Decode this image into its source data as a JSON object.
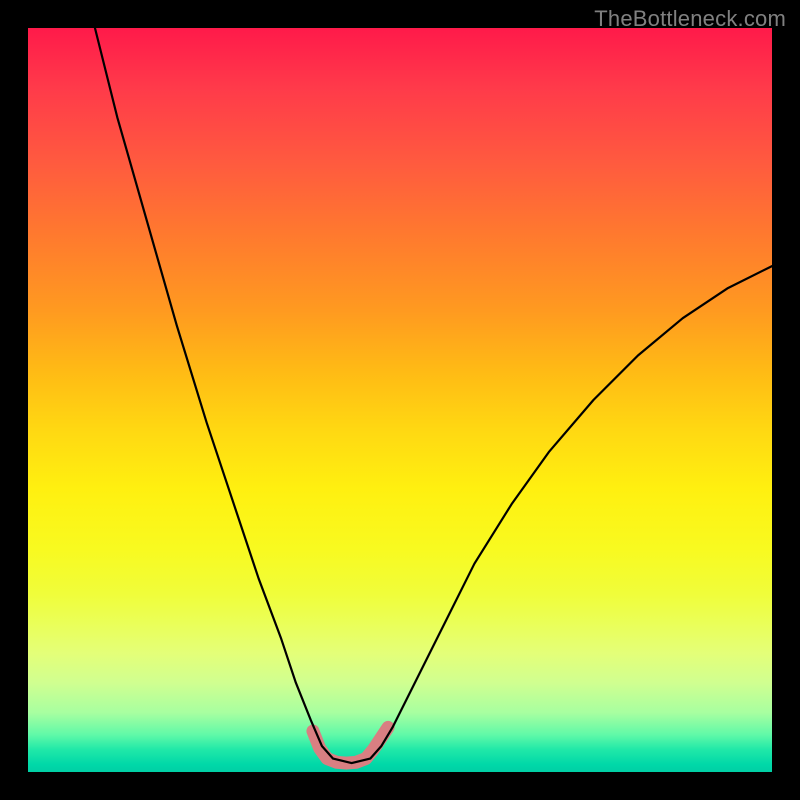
{
  "watermark": "TheBottleneck.com",
  "gradient": {
    "top": "#ff1a4a",
    "bottom": "#00cfa5",
    "direction": "vertical"
  },
  "chart_data": {
    "type": "line",
    "title": "",
    "xlabel": "",
    "ylabel": "",
    "xlim": [
      0,
      100
    ],
    "ylim": [
      0,
      100
    ],
    "series": [
      {
        "name": "main-curve",
        "color": "#000000",
        "stroke_width": 2.2,
        "x": [
          9,
          12,
          16,
          20,
          24,
          28,
          31,
          34,
          36,
          38,
          39.5,
          41,
          43.5,
          46,
          47.5,
          49,
          52,
          56,
          60,
          65,
          70,
          76,
          82,
          88,
          94,
          100
        ],
        "values": [
          100,
          88,
          74,
          60,
          47,
          35,
          26,
          18,
          12,
          7,
          3.5,
          1.8,
          1.2,
          1.8,
          3.5,
          6,
          12,
          20,
          28,
          36,
          43,
          50,
          56,
          61,
          65,
          68
        ]
      },
      {
        "name": "trough-marker",
        "color": "#d97f82",
        "stroke_width": 13,
        "linecap": "round",
        "x": [
          38.3,
          39.2,
          40.2,
          41.5,
          42.8,
          44.1,
          45.4,
          46.4,
          47.4,
          48.4
        ],
        "values": [
          5.5,
          3.2,
          1.8,
          1.3,
          1.2,
          1.3,
          1.8,
          3.0,
          4.5,
          6.0
        ]
      }
    ],
    "grid": false
  }
}
